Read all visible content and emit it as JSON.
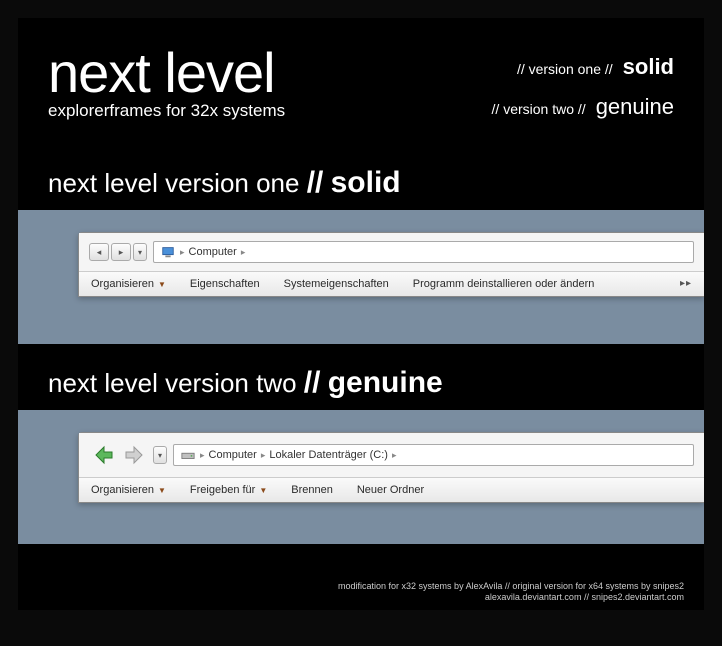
{
  "header": {
    "title": "next level",
    "subtitle": "explorerframes for 32x systems",
    "versions": [
      {
        "prefix": "// version one  //",
        "name": "solid",
        "bold": true
      },
      {
        "prefix": "// version two //",
        "name": "genuine",
        "bold": false
      }
    ]
  },
  "section1": {
    "title_prefix": "next level version one",
    "slashes": "//",
    "name": "solid",
    "breadcrumb": {
      "root": "Computer"
    },
    "toolbar": {
      "organize": "Organisieren",
      "properties": "Eigenschaften",
      "sysprops": "Systemeigenschaften",
      "uninstall": "Programm deinstallieren oder ändern",
      "more": "▸▸"
    }
  },
  "section2": {
    "title_prefix": "next level version two",
    "slashes": "//",
    "name": "genuine",
    "breadcrumb": {
      "root": "Computer",
      "drive": "Lokaler Datenträger (C:)"
    },
    "toolbar": {
      "organize": "Organisieren",
      "share": "Freigeben für",
      "burn": "Brennen",
      "newfolder": "Neuer Ordner"
    }
  },
  "credits": {
    "line1": "modification for x32 systems by AlexAvila // original version for x64 systems by snipes2",
    "line2": "alexavila.deviantart.com // snipes2.deviantart.com"
  }
}
